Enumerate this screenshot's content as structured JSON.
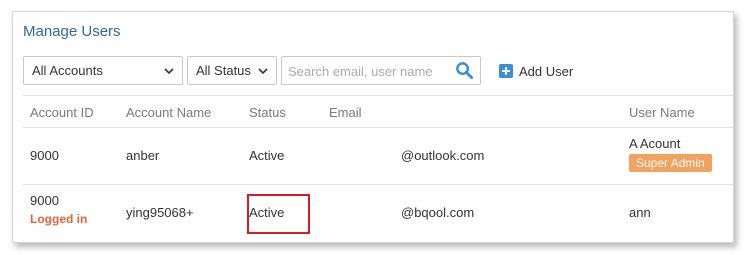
{
  "title": "Manage Users",
  "filters": {
    "accounts": "All Accounts",
    "status": "All Status",
    "search_placeholder": "Search email, user name",
    "add_user": "Add User"
  },
  "columns": [
    "Account ID",
    "Account Name",
    "Status",
    "Email",
    "User Name"
  ],
  "rows": [
    {
      "account_id": "9000",
      "account_name": "anber",
      "status": "Active",
      "email": "@outlook.com",
      "user_name": "A Acount",
      "badge": "Super Admin"
    },
    {
      "account_id": "9000",
      "note": "Logged in",
      "account_name": "ying95068+",
      "status": "Active",
      "email": "@bqool.com",
      "user_name": "ann"
    }
  ],
  "colors": {
    "title": "#2c6aa0",
    "accent": "#3a8ed6",
    "badge": "#f0a25e",
    "logged_in": "#e8623a",
    "highlight": "#d71d24"
  },
  "icons": {
    "dropdown": "chevron-down-icon",
    "search": "search-icon",
    "add": "plus-square-icon"
  }
}
